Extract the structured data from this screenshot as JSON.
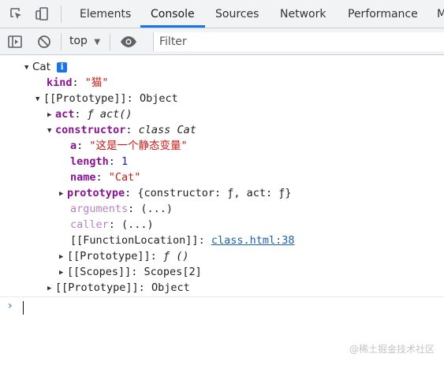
{
  "devtools": {
    "tabs": [
      {
        "label": "Elements"
      },
      {
        "label": "Console"
      },
      {
        "label": "Sources"
      },
      {
        "label": "Network"
      },
      {
        "label": "Performance"
      },
      {
        "label": "M"
      }
    ],
    "active_tab": "Console",
    "accent_color": "#1a73e8"
  },
  "toolbar": {
    "context": "top",
    "filter_placeholder": "Filter"
  },
  "console": {
    "root_label": "Cat",
    "info_badge": "i",
    "kind_key": "kind",
    "kind_value": "\"猫\"",
    "proto1_key": "[[Prototype]]",
    "proto1_value": "Object",
    "act_key": "act",
    "act_value": "ƒ act()",
    "constructor_key": "constructor",
    "constructor_class": "class",
    "constructor_name": "Cat",
    "a_key": "a",
    "a_value": "\"这是一个静态变量\"",
    "length_key": "length",
    "length_value": "1",
    "name_key": "name",
    "name_value": "\"Cat\"",
    "prototype_key": "prototype",
    "prototype_value": "{constructor: ƒ, act: ƒ}",
    "arguments_key": "arguments",
    "arguments_value": "(...)",
    "caller_key": "caller",
    "caller_value": "(...)",
    "function_location_key": "[[FunctionLocation]]",
    "function_location_link": "class.html:38",
    "inner_proto_key": "[[Prototype]]",
    "inner_proto_value": "ƒ ()",
    "scopes_key": "[[Scopes]]",
    "scopes_value": "Scopes[2]",
    "outer_proto_key": "[[Prototype]]",
    "outer_proto_value": "Object"
  },
  "watermark": "@稀土掘金技术社区"
}
